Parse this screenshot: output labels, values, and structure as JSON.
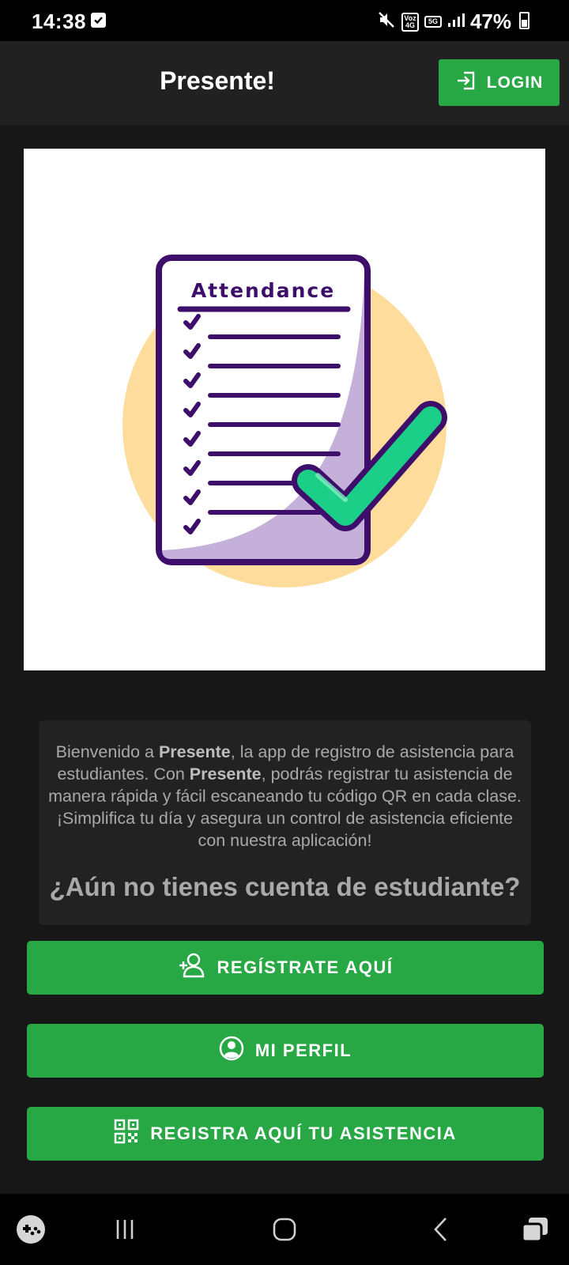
{
  "status_bar": {
    "time": "14:38",
    "volte_badge": "Voz 4G",
    "network_badge": "5G",
    "battery_percent": "47%",
    "icons": [
      "checkbox-notification-icon",
      "muted-icon",
      "volte-icon",
      "5g-icon",
      "signal-icon",
      "battery-icon"
    ]
  },
  "app_bar": {
    "title": "Presente!",
    "login_label": "LOGIN",
    "login_icon": "login-icon"
  },
  "hero": {
    "illustration_heading": "Attendance",
    "icon": "attendance-checklist-illustration"
  },
  "welcome": {
    "parts": [
      "Bienvenido a ",
      "Presente",
      ", la app de registro de asistencia para estudiantes. Con ",
      "Presente",
      ", podrás registrar tu asistencia de manera rápida y fácil escaneando tu código QR en cada clase. ¡Simplifica tu día y asegura un control de asistencia eficiente con nuestra aplicación!"
    ],
    "question": "¿Aún no tienes cuenta de estudiante?"
  },
  "buttons": {
    "register": "REGÍSTRATE AQUÍ",
    "profile": "MI PERFIL",
    "attendance": "REGISTRA AQUÍ TU ASISTENCIA"
  },
  "colors": {
    "accent": "#28a745",
    "background": "#171717",
    "app_bar": "#212121"
  }
}
